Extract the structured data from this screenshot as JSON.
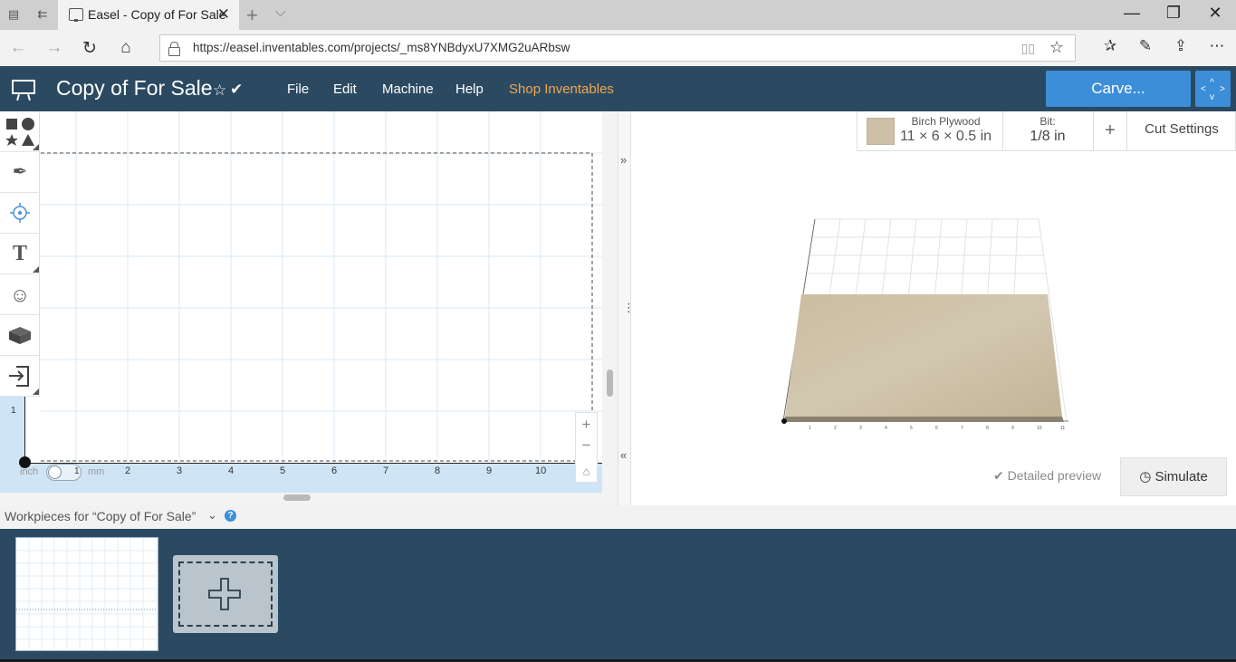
{
  "browser": {
    "tab_title": "Easel - Copy of For Sale",
    "url": "https://easel.inventables.com/projects/_ms8YNBdyxU7XMG2uARbsw"
  },
  "app": {
    "project_title": "Copy of For Sale",
    "menu": [
      "File",
      "Edit",
      "Machine",
      "Help",
      "Shop Inventables"
    ],
    "carve_label": "Carve...",
    "accent_color": "#3d8ed8",
    "header_color": "#2b4a62",
    "shop_color": "#f0a64d"
  },
  "palette": {
    "tools": [
      "shapes-icon",
      "pen-icon",
      "point-icon",
      "text-icon",
      "icons-emoji-icon",
      "apps-icon",
      "import-icon"
    ]
  },
  "canvas": {
    "unit_left": "inch",
    "unit_right": "mm",
    "toggle_value": "1",
    "left_ruler_value": "1",
    "x_ruler": [
      "2",
      "3",
      "4",
      "5",
      "6",
      "7",
      "8",
      "9",
      "10"
    ]
  },
  "material": {
    "name": "Birch Plywood",
    "dimensions": "11 × 6 × 0.5 in",
    "bit_label": "Bit:",
    "bit_value": "1/8 in",
    "add_label": "+",
    "cut_settings": "Cut Settings"
  },
  "preview": {
    "detailed_preview": "Detailed preview",
    "simulate": "Simulate"
  },
  "workpieces": {
    "title": "Workpieces for “Copy of For Sale”",
    "help": "?"
  }
}
